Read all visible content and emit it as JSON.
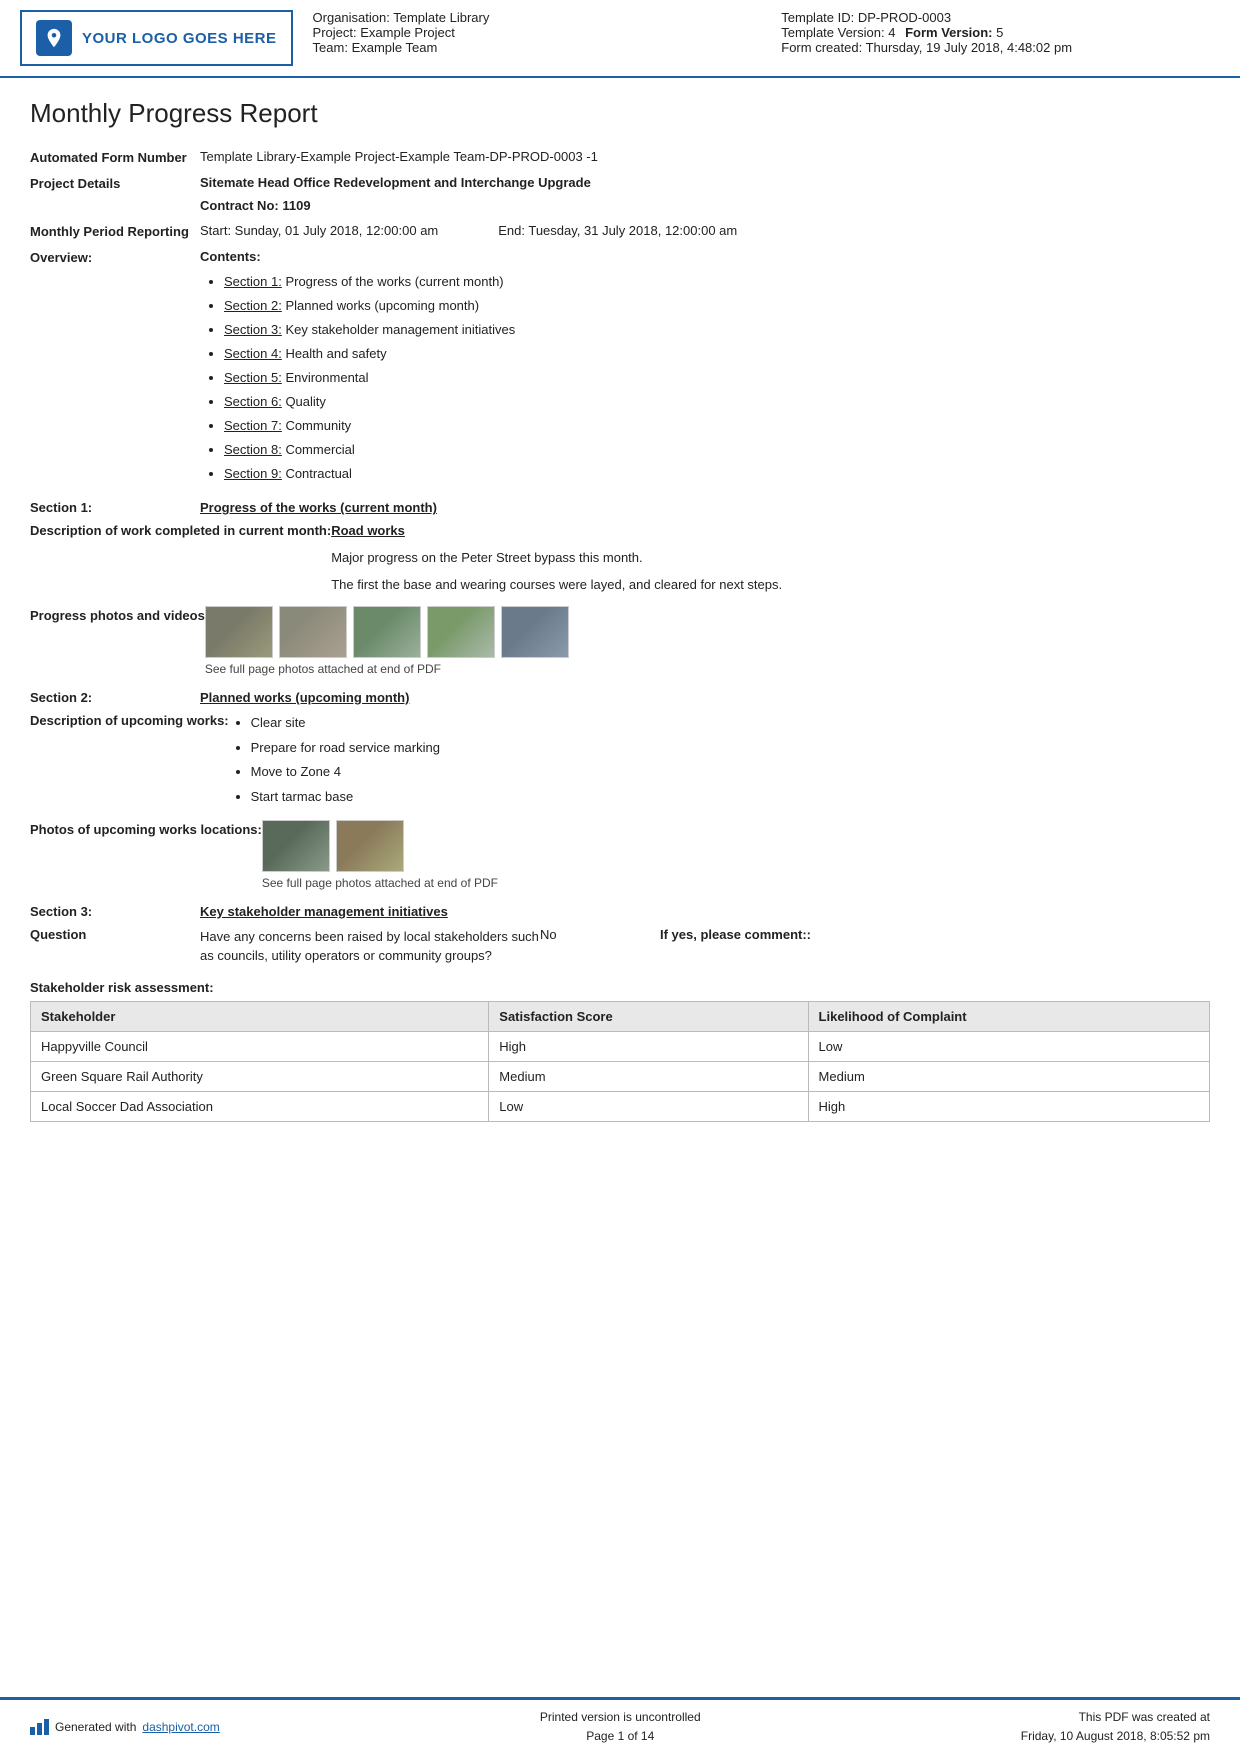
{
  "header": {
    "logo_text": "YOUR LOGO GOES HERE",
    "org_label": "Organisation:",
    "org_value": "Template Library",
    "project_label": "Project:",
    "project_value": "Example Project",
    "team_label": "Team:",
    "team_value": "Example Team",
    "template_id_label": "Template ID:",
    "template_id_value": "DP-PROD-0003",
    "template_version_label": "Template Version:",
    "template_version_value": "4",
    "form_version_label": "Form Version:",
    "form_version_value": "5",
    "form_created_label": "Form created:",
    "form_created_value": "Thursday, 19 July 2018, 4:48:02 pm"
  },
  "report": {
    "title": "Monthly Progress Report",
    "form_number_label": "Automated Form Number",
    "form_number_value": "Template Library-Example Project-Example Team-DP-PROD-0003   -1",
    "project_details_label": "Project Details",
    "project_details_value": "Sitemate Head Office Redevelopment and Interchange Upgrade",
    "contract_label": "Contract No:",
    "contract_value": "1109",
    "period_label": "Monthly Period Reporting",
    "period_start": "Start: Sunday, 01 July 2018, 12:00:00 am",
    "period_end": "End: Tuesday, 31 July 2018, 12:00:00 am",
    "overview_label": "Overview:",
    "contents_label": "Contents:",
    "contents_items": [
      {
        "link": "Section 1:",
        "text": " Progress of the works (current month)"
      },
      {
        "link": "Section 2:",
        "text": " Planned works (upcoming month)"
      },
      {
        "link": "Section 3:",
        "text": " Key stakeholder management initiatives"
      },
      {
        "link": "Section 4:",
        "text": " Health and safety"
      },
      {
        "link": "Section 5:",
        "text": " Environmental"
      },
      {
        "link": "Section 6:",
        "text": " Quality"
      },
      {
        "link": "Section 7:",
        "text": " Community"
      },
      {
        "link": "Section 8:",
        "text": " Commercial"
      },
      {
        "link": "Section 9:",
        "text": " Contractual"
      }
    ],
    "section1_label": "Section 1:",
    "section1_title": "Progress of the works (current month)",
    "desc_work_label": "Description of work completed in current month:",
    "desc_work_subheading": "Road works",
    "desc_work_line1": "Major progress on the Peter Street bypass this month.",
    "desc_work_line2": "The first the base and wearing courses were layed, and cleared for next steps.",
    "photos_label": "Progress photos and videos",
    "photos_caption": "See full page photos attached at end of PDF",
    "section2_label": "Section 2:",
    "section2_title": "Planned works (upcoming month)",
    "upcoming_label": "Description of upcoming works:",
    "upcoming_items": [
      "Clear site",
      "Prepare for road service marking",
      "Move to Zone 4",
      "Start tarmac base"
    ],
    "upcoming_photos_label": "Photos of upcoming works locations:",
    "upcoming_photos_caption": "See full page photos attached at end of PDF",
    "section3_label": "Section 3:",
    "section3_title": "Key stakeholder management initiatives",
    "question_label": "Question",
    "question_text": "Have any concerns been raised by local stakeholders such as councils, utility operators or community groups?",
    "question_answer": "No",
    "question_comment": "If yes, please comment::",
    "stakeholder_heading": "Stakeholder risk assessment:",
    "table_headers": [
      "Stakeholder",
      "Satisfaction Score",
      "Likelihood of Complaint"
    ],
    "table_rows": [
      [
        "Happyville Council",
        "High",
        "Low"
      ],
      [
        "Green Square Rail Authority",
        "Medium",
        "Medium"
      ],
      [
        "Local Soccer Dad Association",
        "Low",
        "High"
      ]
    ]
  },
  "footer": {
    "generated_text": "Generated with",
    "link_text": "dashpivot.com",
    "center_line1": "Printed version is uncontrolled",
    "center_line2": "Page 1 of 14",
    "right_line1": "This PDF was created at",
    "right_line2": "Friday, 10 August 2018, 8:05:52 pm"
  }
}
